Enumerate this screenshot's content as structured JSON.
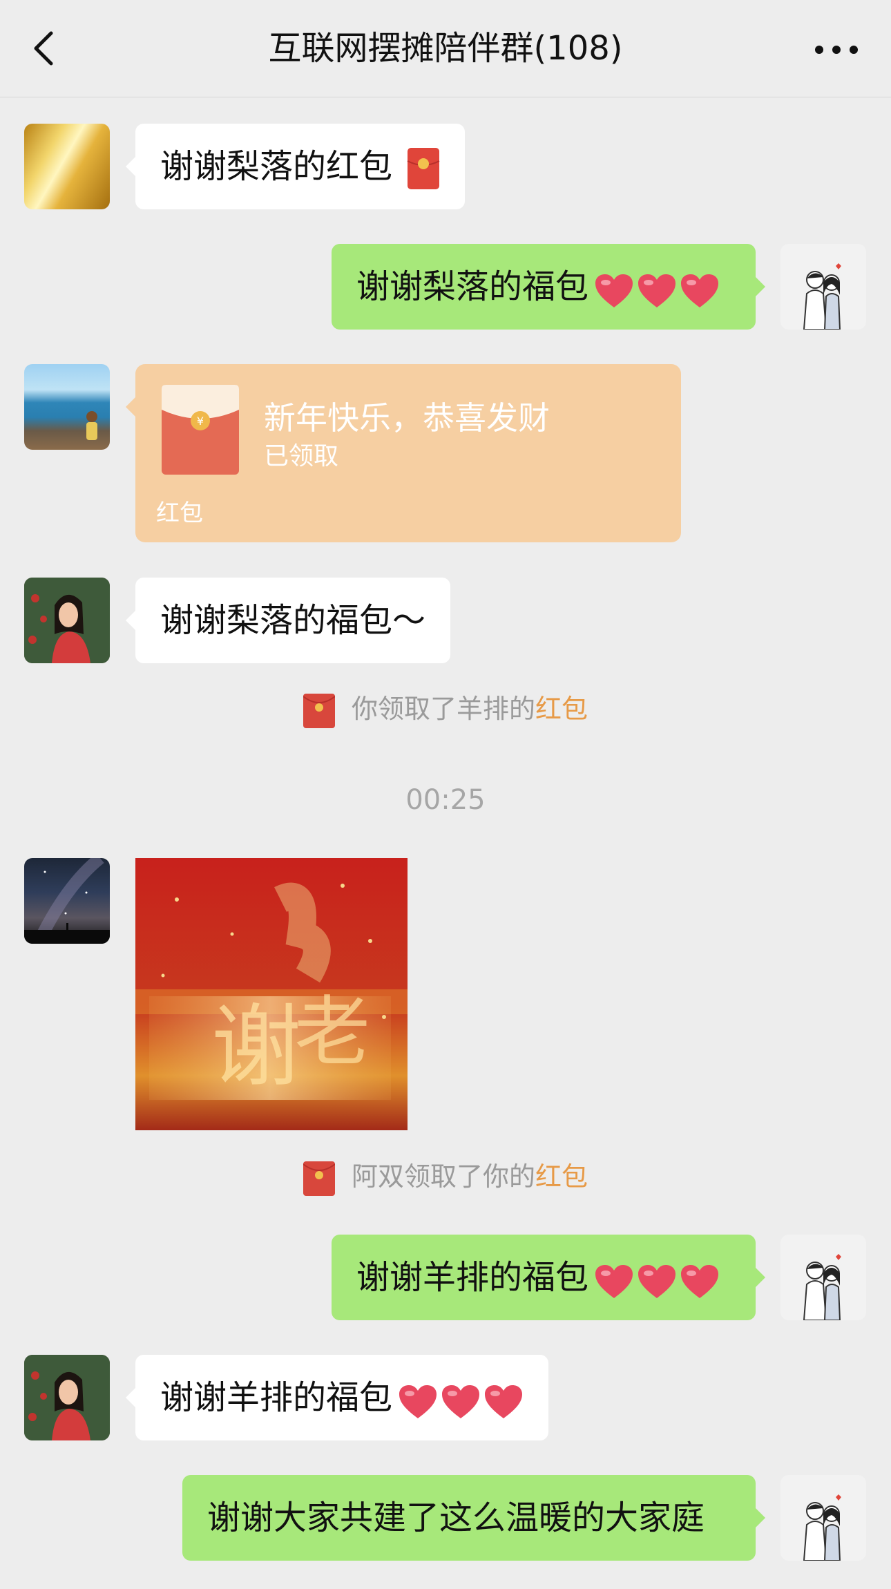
{
  "header": {
    "title": "互联网摆摊陪伴群(108)",
    "back_icon": "chevron-left-icon",
    "more_icon": "more-dots-icon"
  },
  "messages": {
    "m1": {
      "text": "谢谢梨落的红包"
    },
    "m2": {
      "text": "谢谢梨落的福包"
    },
    "redpacket": {
      "greeting": "新年快乐，恭喜发财",
      "status": "已领取",
      "label": "红包"
    },
    "m4": {
      "text": "谢谢梨落的福包～"
    },
    "sys1": {
      "prefix": "你领取了羊排的",
      "link": "红包"
    },
    "time": "00:25",
    "sys2": {
      "prefix": "阿双领取了你的",
      "link": "红包"
    },
    "m6": {
      "text": "谢谢羊排的福包"
    },
    "m7": {
      "text": "谢谢羊排的福包"
    },
    "m8": {
      "text": "谢谢大家共建了这么温暖的大家庭"
    }
  },
  "colors": {
    "bg": "#ededed",
    "green_bubble": "#a7e87a",
    "redpacket": "#f6cfa2",
    "link": "#e79a47"
  }
}
